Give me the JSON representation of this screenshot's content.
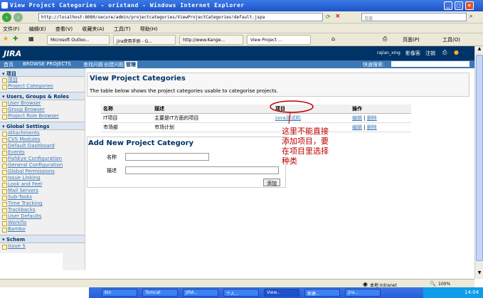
{
  "window": {
    "title": "View Project Categories - orixtand - Windows Internet Explorer"
  },
  "browser": {
    "url": "http://localhost:8080/secure/admin/projectcategories/ViewProjectCategories!default.jspa",
    "search_placeholder": "百度",
    "menu": [
      "文件(F)",
      "编辑(E)",
      "查看(V)",
      "收藏夹(A)",
      "工具(T)",
      "帮助(H)"
    ],
    "tabs": [
      "Microsoft Outloo...",
      "jira使用手册 - G...",
      "http://www.Kange...",
      "View Project ..."
    ],
    "toolbar_right": {
      "page": "页面(P)",
      "tools": "工具(O)"
    }
  },
  "jira": {
    "logo": "JIRA",
    "user": "rajian_xing",
    "user_links": [
      "影像客",
      "注销"
    ],
    "nav": [
      "首页",
      "BROWSE PROJECTS",
      "查找问题",
      "创建问题",
      "管理"
    ],
    "quick_search": "快速搜索:"
  },
  "sidebar": {
    "sections": [
      {
        "title": "项目",
        "items": [
          "项目",
          "Project Categories"
        ]
      },
      {
        "title": "Users, Groups & Roles",
        "items": [
          "User Browser",
          "Group Browser",
          "Project Role Browser"
        ]
      },
      {
        "title": "Global Settings",
        "items": [
          "Attachments",
          "CVS Modules",
          "Default Dashboard",
          "Events",
          "FishEye Configuration",
          "General Configuration",
          "Global Permissions",
          "Issue Linking",
          "Look and Feel",
          "Mail Servers",
          "Sub-Tasks",
          "Time Tracking",
          "Trackbacks",
          "User Defaults",
          "Workflo",
          "Bambo"
        ]
      },
      {
        "title": "Schem",
        "items": [
          "Issue S"
        ]
      }
    ]
  },
  "main": {
    "title": "View Project Categories",
    "description": "The table below shows the project categories usable to categorise projects.",
    "table": {
      "headers": [
        "名称",
        "描述",
        "项目",
        "操作"
      ],
      "rows": [
        {
          "name": "IT项目",
          "desc": "主要是IT方面的项目",
          "project": "Java测试机",
          "edit": "编辑",
          "delete": "删除"
        },
        {
          "name": "市场部",
          "desc": "市场计划",
          "project": "",
          "edit": "编辑",
          "delete": "删除"
        }
      ]
    },
    "add_form": {
      "title": "Add New Project Category",
      "name_label": "名称",
      "desc_label": "描述",
      "submit": "添加"
    },
    "annotation": "这里不能直接\n添加项目，要\n在项目里选择\n种类"
  },
  "statusbar": {
    "zone": "本地 Intranet",
    "zoom": "100%"
  },
  "taskbar": {
    "items": [
      "bin",
      "Tomcat",
      "JIRA...",
      "个人...",
      "View...",
      "新建...",
      "jira..."
    ],
    "clock": "14:04"
  },
  "colors": {
    "jira_header": "#003366",
    "jira_nav": "#3c78b5",
    "link": "#3c78b5",
    "annotation": "#c00000"
  }
}
